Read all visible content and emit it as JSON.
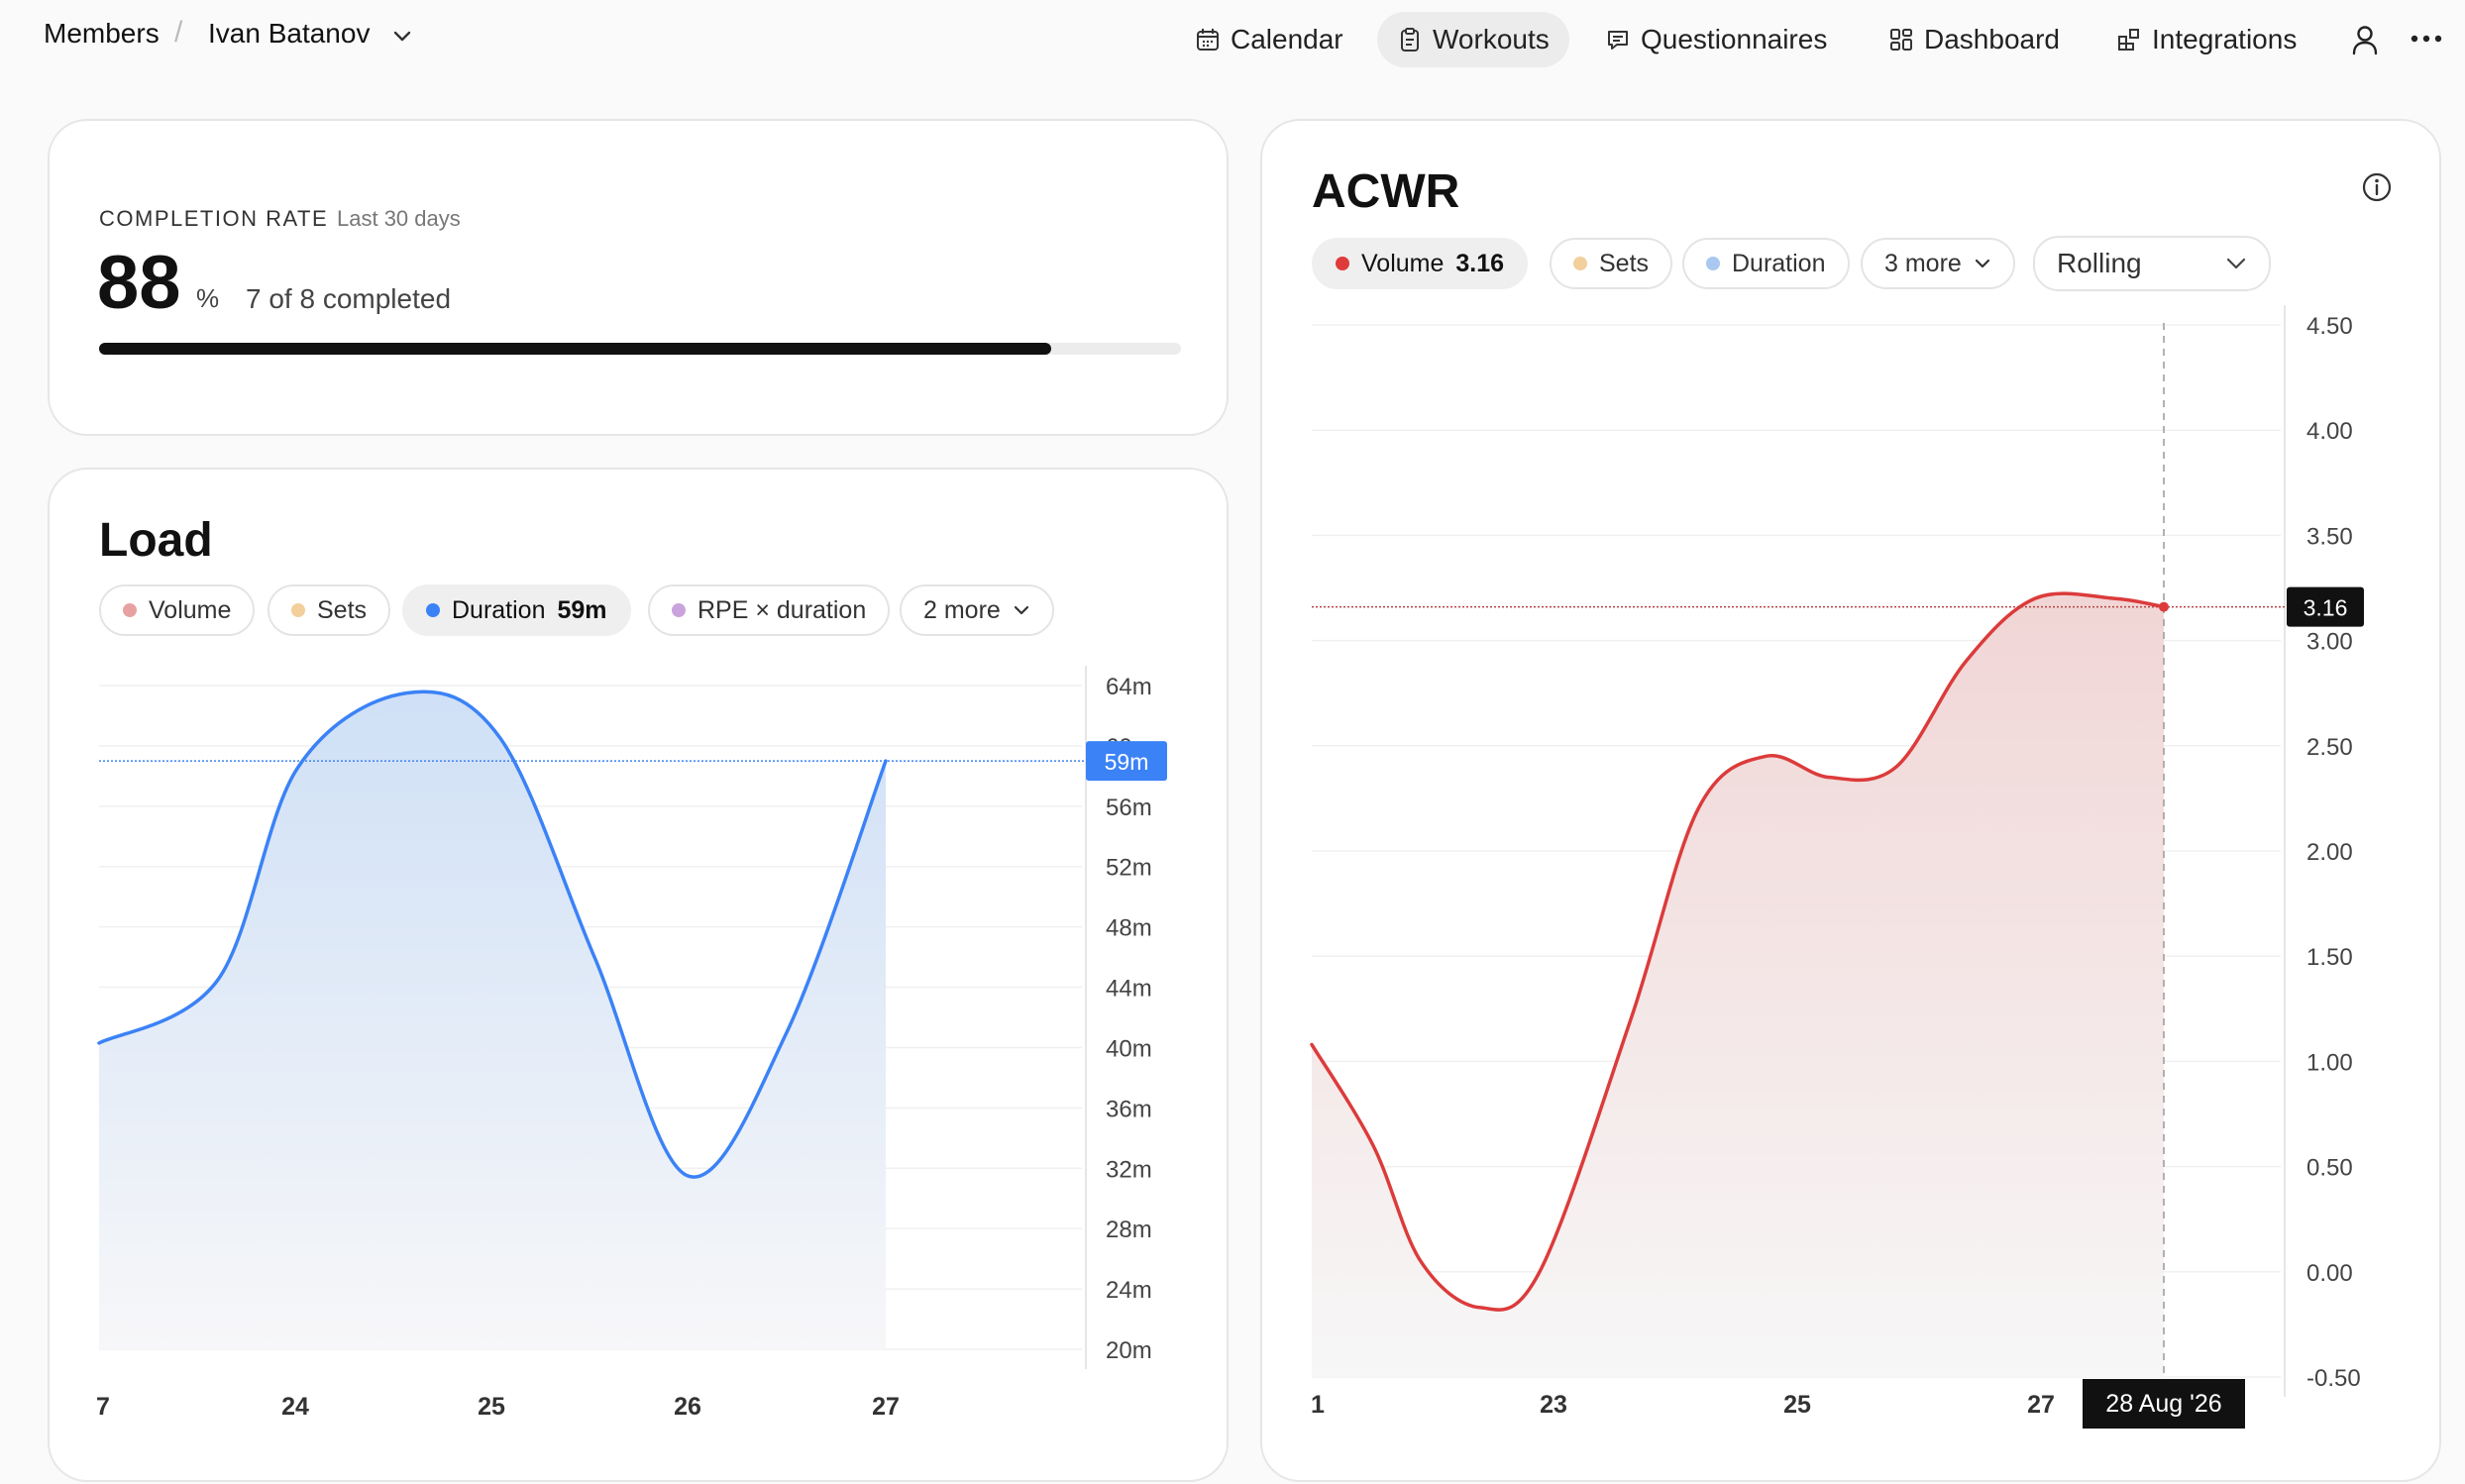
{
  "breadcrumb": {
    "root": "Members",
    "member": "Ivan Batanov"
  },
  "nav": {
    "items": [
      {
        "label": "Calendar",
        "icon": "calendar-icon",
        "active": false
      },
      {
        "label": "Workouts",
        "icon": "clipboard-icon",
        "active": true
      },
      {
        "label": "Questionnaires",
        "icon": "message-icon",
        "active": false
      },
      {
        "label": "Dashboard",
        "icon": "grid-icon",
        "active": false
      },
      {
        "label": "Integrations",
        "icon": "blocks-icon",
        "active": false
      }
    ]
  },
  "completion": {
    "label": "COMPLETION RATE",
    "period": "Last 30 days",
    "value": "88",
    "unit": "%",
    "detail": "7 of 8 completed",
    "progress": 0.88
  },
  "load": {
    "title": "Load",
    "chips": [
      {
        "label": "Volume",
        "value": "",
        "color": "#e8a1a1",
        "active": false
      },
      {
        "label": "Sets",
        "value": "",
        "color": "#f3cf9c",
        "active": false
      },
      {
        "label": "Duration",
        "value": "59m",
        "color": "#3b82f6",
        "active": true
      },
      {
        "label": "RPE × duration",
        "value": "",
        "color": "#c9a3dd",
        "active": false
      }
    ],
    "more_label": "2 more",
    "marker_label": "59m"
  },
  "acwr": {
    "title": "ACWR",
    "chips": [
      {
        "label": "Volume",
        "value": "3.16",
        "color": "#e03b3b",
        "active": true
      },
      {
        "label": "Sets",
        "value": "",
        "color": "#f3cf9c",
        "active": false
      },
      {
        "label": "Duration",
        "value": "",
        "color": "#a8c8f0",
        "active": false
      }
    ],
    "more_label": "3 more",
    "select_label": "Rolling",
    "marker_label": "3.16",
    "date_label": "28 Aug '26"
  },
  "chart_data": [
    {
      "type": "area",
      "title": "Load",
      "series": [
        {
          "name": "Duration",
          "x": [
            "23",
            "23.5",
            "24",
            "24.5",
            "25",
            "25.5",
            "26",
            "26.5",
            "27"
          ],
          "values": [
            40.3,
            44.5,
            58.5,
            63.5,
            60.5,
            46,
            31.5,
            41,
            59
          ],
          "color": "#3b82f6"
        }
      ],
      "x_ticks": [
        "7",
        "24",
        "25",
        "26",
        "27"
      ],
      "y_ticks": [
        "64m",
        "60m",
        "56m",
        "52m",
        "48m",
        "44m",
        "40m",
        "36m",
        "32m",
        "28m",
        "24m",
        "20m"
      ],
      "ylim": [
        20,
        64
      ],
      "highlight": 59
    },
    {
      "type": "area",
      "title": "ACWR",
      "series": [
        {
          "name": "Volume",
          "x": [
            "21",
            "21.5",
            "22",
            "22.5",
            "23",
            "24",
            "24.5",
            "25",
            "25.5",
            "26",
            "26.5",
            "27",
            "27.5",
            "28"
          ],
          "values": [
            1.08,
            0.6,
            0.05,
            -0.17,
            0.0,
            1.2,
            2.2,
            2.45,
            2.35,
            2.4,
            2.9,
            3.2,
            3.2,
            3.16
          ],
          "color": "#dc3b3b"
        }
      ],
      "x_ticks": [
        "1",
        "23",
        "25",
        "27"
      ],
      "y_ticks": [
        "4.50",
        "4.00",
        "3.50",
        "3.00",
        "2.50",
        "2.00",
        "1.50",
        "1.00",
        "0.50",
        "0.00",
        "-0.50"
      ],
      "ylim": [
        -0.5,
        4.5
      ],
      "highlight": 3.16
    }
  ]
}
